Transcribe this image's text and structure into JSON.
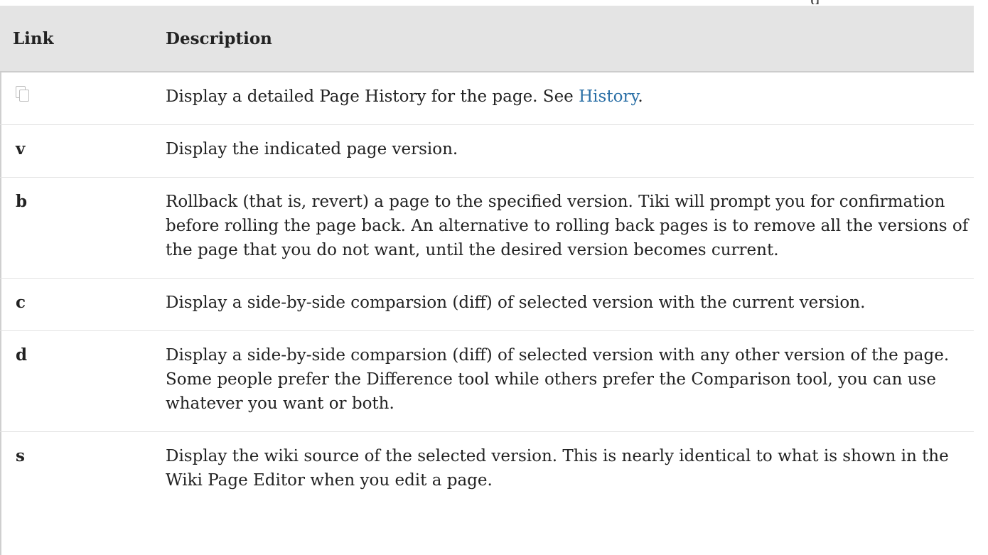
{
  "top_fragment": "g",
  "table": {
    "headers": {
      "link": "Link",
      "description": "Description"
    },
    "rows": [
      {
        "link": "",
        "link_icon": "history-copy-icon",
        "description_prefix": "Display a detailed Page History for the page. See ",
        "description_link": "History",
        "description_suffix": "."
      },
      {
        "link": "v",
        "description": "Display the indicated page version."
      },
      {
        "link": "b",
        "description": "Rollback (that is, revert) a page to the specified version. Tiki will prompt you for confirmation before rolling the page back. An alternative to rolling back pages is to remove all the versions of the page that you do not want, until the desired version becomes current."
      },
      {
        "link": "c",
        "description": "Display a side-by-side comparsion (diff) of selected version with the current version."
      },
      {
        "link": "d",
        "description": "Display a side-by-side comparsion (diff) of selected version with any other version of the page. Some people prefer the Difference tool while others prefer the Comparison tool, you can use whatever you want or both."
      },
      {
        "link": "s",
        "description": "Display the wiki source of the selected version. This is nearly identical to what is shown in the Wiki Page Editor when you edit a page."
      }
    ]
  },
  "colors": {
    "header_background": "#e4e4e4",
    "link_color": "#2a6fa6",
    "text_color": "#222222"
  }
}
